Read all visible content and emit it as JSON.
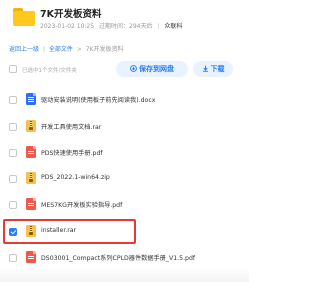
{
  "header": {
    "title": "7K开发板资料",
    "date": "2023-01-02 10:25",
    "expiry": "过期时间：294天后",
    "separator": "|",
    "owner": "众联科"
  },
  "breadcrumb": {
    "back": "返回上一级",
    "sep1": "|",
    "all_files": "全部文件",
    "gt": ">",
    "current": "7K开发板资料"
  },
  "toolbar": {
    "select_status": "已选中1个文件/文件夹",
    "save_label": "保存到网盘",
    "download_label": "下载"
  },
  "files": [
    {
      "name": "驱动安装说明(使用板子前先阅读我).docx",
      "type": "doc",
      "checked": false
    },
    {
      "name": "开发工具使用文档.rar",
      "type": "rar",
      "checked": false
    },
    {
      "name": "PDS快速使用手册.pdf",
      "type": "pdf",
      "checked": false
    },
    {
      "name": "PDS_2022.1-win64.zip",
      "type": "rar",
      "checked": false
    },
    {
      "name": "MES7KG开发板实验指导.pdf",
      "type": "pdf",
      "checked": false
    },
    {
      "name": "installer.rar",
      "type": "rar",
      "checked": true
    },
    {
      "name": "DS03001_Compact系列CPLD器件数据手册_V1.5.pdf",
      "type": "pdf",
      "checked": false
    }
  ],
  "colors": {
    "accent": "#2b7cf6",
    "highlight": "#e53935",
    "folder": "#ffc81f"
  }
}
